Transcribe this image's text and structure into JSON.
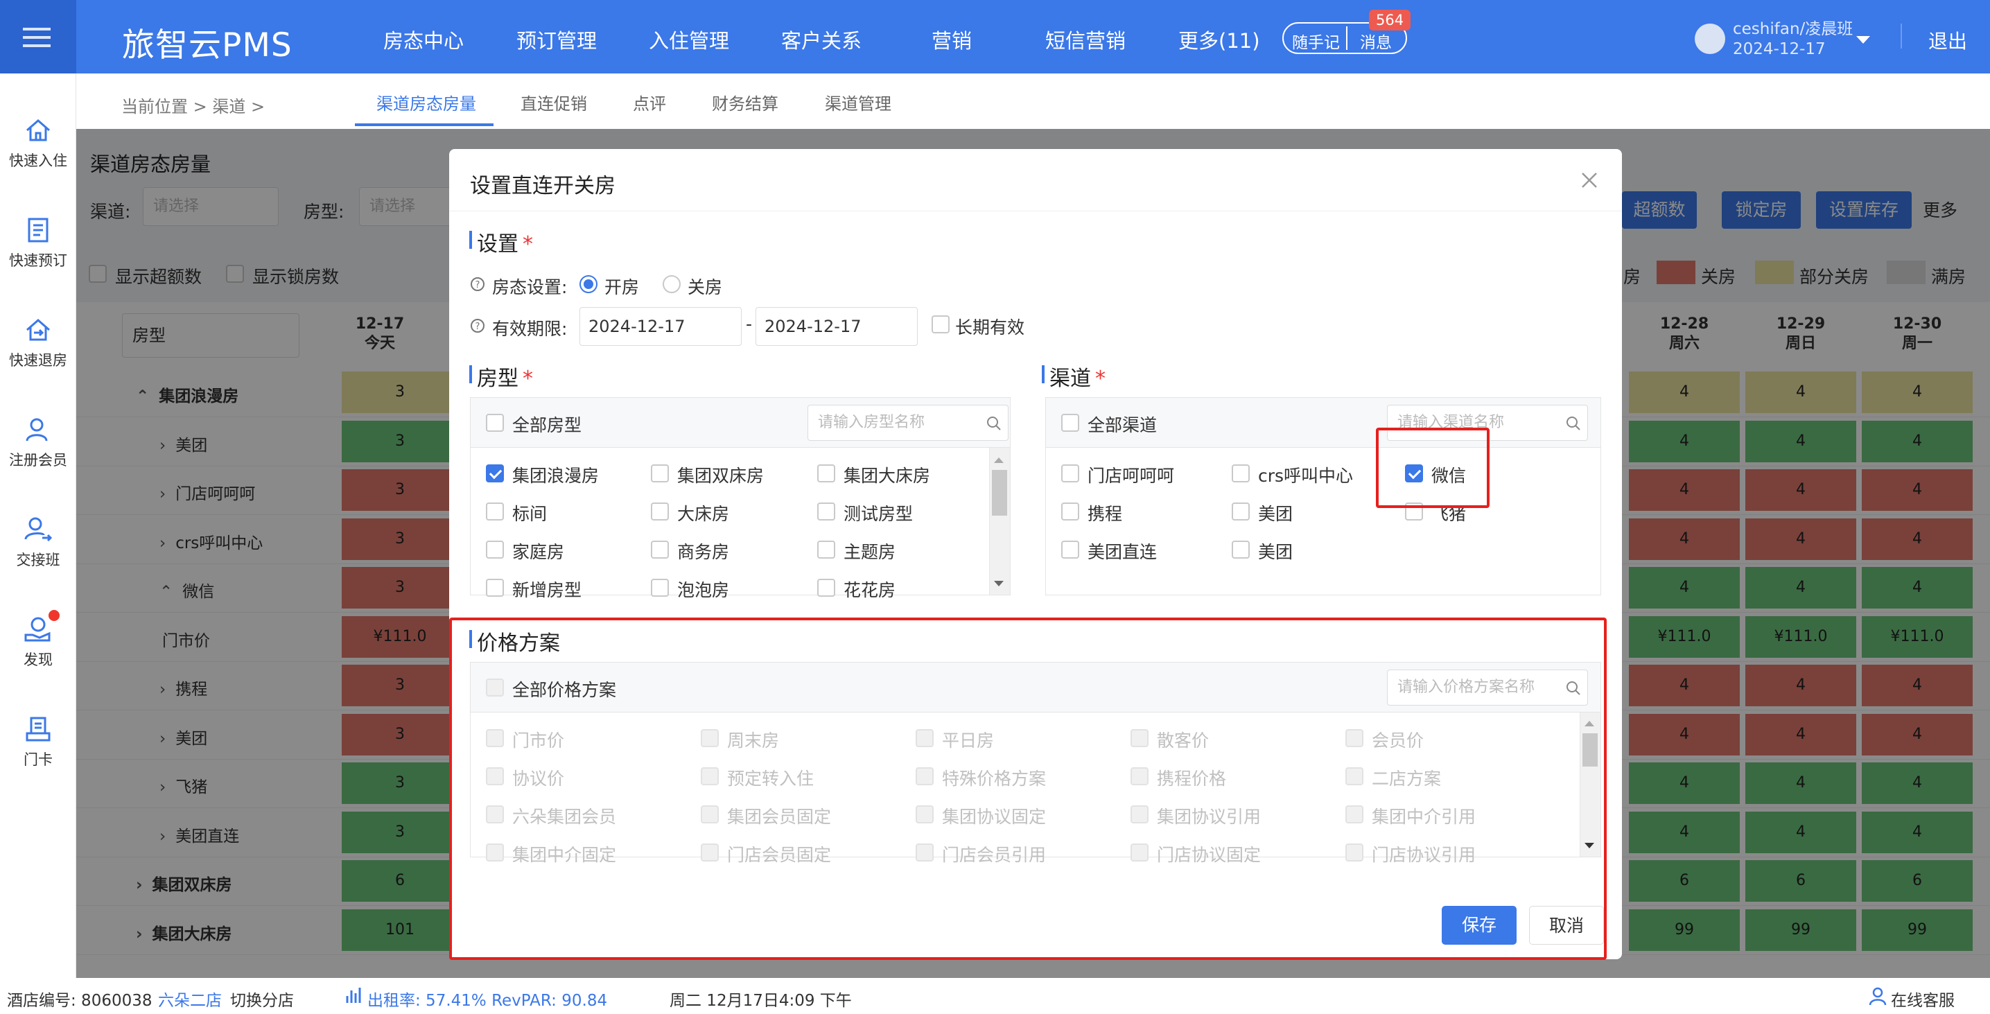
{
  "app": {
    "logo": "旅智云PMS",
    "nav": [
      "房态中心",
      "预订管理",
      "入住管理",
      "客户关系",
      "营销",
      "短信营销",
      "更多(11)"
    ],
    "notes": "随手记",
    "msgs": "消息",
    "msg_count": "564",
    "user": "ceshifan/凌晨班",
    "date": "2024-12-17",
    "logout": "退出"
  },
  "sidebar": [
    "快速入住",
    "快速预订",
    "快速退房",
    "注册会员",
    "交接班",
    "发现",
    "门卡"
  ],
  "crumb": "当前位置 > 渠道 >",
  "tabs": [
    "渠道房态房量",
    "直连促销",
    "点评",
    "财务结算",
    "渠道管理"
  ],
  "page": {
    "title": "渠道房态房量",
    "channel_label": "渠道:",
    "channel_ph": "请选择",
    "room_label": "房型:",
    "room_ph": "请选择",
    "show_over": "显示超额数",
    "show_lock": "显示锁房数",
    "roomtype_sel": "房型",
    "btn_over": "超额数",
    "btn_lock": "锁定房",
    "btn_stock": "设置库存",
    "more": "更多",
    "legend": [
      "房",
      "关房",
      "部分关房",
      "满房"
    ]
  },
  "grid": {
    "first_date": "12-17",
    "first_day": "今天",
    "dates": [
      {
        "d": "12-28",
        "w": "周六"
      },
      {
        "d": "12-29",
        "w": "周日"
      },
      {
        "d": "12-30",
        "w": "周一"
      }
    ],
    "rows": [
      {
        "label": "集团浪漫房",
        "first": "3",
        "right": [
          "4",
          "4",
          "4"
        ]
      },
      {
        "label": "美团",
        "first": "3",
        "right": [
          "4",
          "4",
          "4"
        ]
      },
      {
        "label": "门店呵呵呵",
        "first": "3",
        "right": [
          "4",
          "4",
          "4"
        ]
      },
      {
        "label": "crs呼叫中心",
        "first": "3",
        "right": [
          "4",
          "4",
          "4"
        ]
      },
      {
        "label": "微信",
        "first": "3",
        "right": [
          "4",
          "4",
          "4"
        ]
      },
      {
        "label": "门市价",
        "first": "¥111.0",
        "right": [
          "¥111.0",
          "¥111.0",
          "¥111.0"
        ]
      },
      {
        "label": "携程",
        "first": "3",
        "right": [
          "4",
          "4",
          "4"
        ]
      },
      {
        "label": "美团",
        "first": "3",
        "right": [
          "4",
          "4",
          "4"
        ]
      },
      {
        "label": "飞猪",
        "first": "3",
        "right": [
          "4",
          "4",
          "4"
        ]
      },
      {
        "label": "美团直连",
        "first": "3",
        "right": [
          "4",
          "4",
          "4"
        ]
      },
      {
        "label": "集团双床房",
        "first": "6",
        "right": [
          "6",
          "6",
          "6"
        ]
      },
      {
        "label": "集团大床房",
        "first": "101",
        "right": [
          "99",
          "99",
          "99"
        ]
      }
    ]
  },
  "dialog": {
    "title": "设置直连开关房",
    "settings": "设置",
    "status_label": "房态设置:",
    "open": "开房",
    "close": "关房",
    "valid_label": "有效期限:",
    "date_from": "2024-12-17",
    "date_sep": "-",
    "date_to": "2024-12-17",
    "long_valid": "长期有效",
    "roomtype": "房型",
    "all_rooms": "全部房型",
    "room_ph": "请输入房型名称",
    "rooms": [
      "集团浪漫房",
      "集团双床房",
      "集团大床房",
      "标间",
      "大床房",
      "测试房型",
      "家庭房",
      "商务房",
      "主题房",
      "新增房型",
      "泡泡房",
      "花花房"
    ],
    "channel": "渠道",
    "all_channels": "全部渠道",
    "channel_ph": "请输入渠道名称",
    "channels": [
      "门店呵呵呵",
      "crs呼叫中心",
      "微信",
      "携程",
      "美团",
      "飞猪",
      "美团直连",
      "美团"
    ],
    "price": "价格方案",
    "all_prices": "全部价格方案",
    "price_ph": "请输入价格方案名称",
    "prices": [
      "门市价",
      "周末房",
      "平日房",
      "散客价",
      "会员价",
      "协议价",
      "预定转入住",
      "特殊价格方案",
      "携程价格",
      "二店方案",
      "六朵集团会员",
      "集团会员固定",
      "集团协议固定",
      "集团协议引用",
      "集团中介引用",
      "集团中介固定",
      "门店会员固定",
      "门店会员引用",
      "门店协议固定",
      "门店协议引用"
    ],
    "save": "保存",
    "cancel": "取消"
  },
  "status": {
    "hotel": "酒店编号:  8060038",
    "branch": "六朵二店",
    "switch": "切换分店",
    "occ": "出租率:  57.41%  RevPAR:  90.84",
    "time": "周二  12月17日4:09 下午",
    "service": "在线客服"
  }
}
